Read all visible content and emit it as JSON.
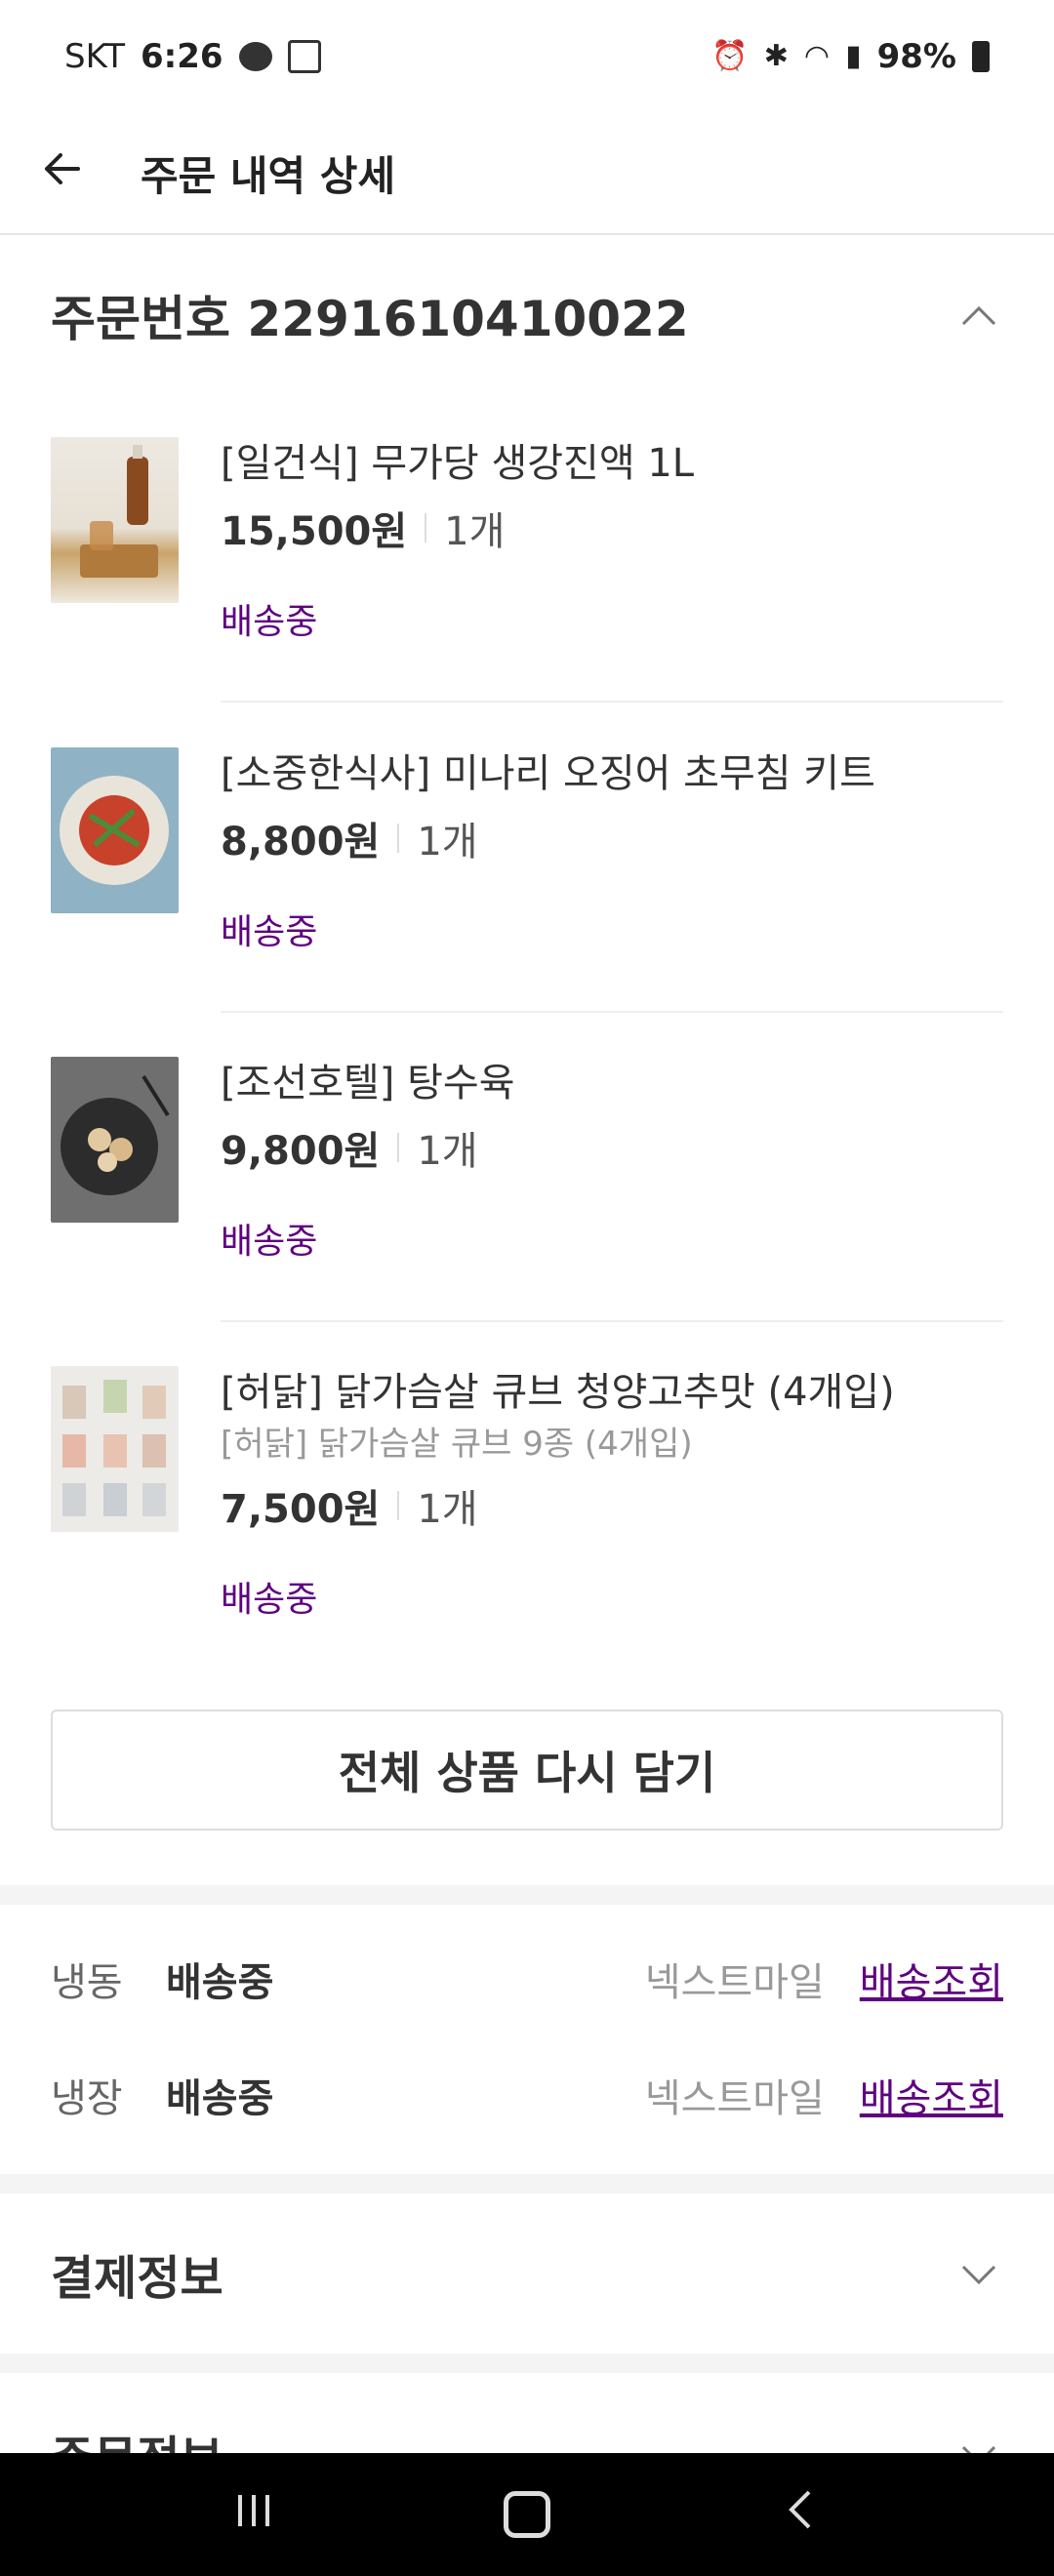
{
  "status_bar": {
    "carrier": "SKT",
    "time": "6:26",
    "battery": "98%"
  },
  "header": {
    "title": "주문 내역 상세"
  },
  "order": {
    "number_label": "주문번호 2291610410022"
  },
  "items": [
    {
      "name": "[일건식] 무가당 생강진액 1L",
      "price": "15,500원",
      "qty": "1개",
      "status": "배송중"
    },
    {
      "name": "[소중한식사] 미나리 오징어 초무침 키트",
      "price": "8,800원",
      "qty": "1개",
      "status": "배송중"
    },
    {
      "name": "[조선호텔] 탕수육",
      "price": "9,800원",
      "qty": "1개",
      "status": "배송중"
    },
    {
      "name": "[허닭] 닭가슴살 큐브 청양고추맛 (4개입)",
      "option": "[허닭] 닭가슴살 큐브 9종 (4개입)",
      "price": "7,500원",
      "qty": "1개",
      "status": "배송중"
    }
  ],
  "reorder_label": "전체 상품 다시 담기",
  "delivery": [
    {
      "type": "냉동",
      "status": "배송중",
      "carrier": "넥스트마일",
      "track": "배송조회"
    },
    {
      "type": "냉장",
      "status": "배송중",
      "carrier": "넥스트마일",
      "track": "배송조회"
    }
  ],
  "sections": {
    "payment": "결제정보",
    "order_info": "주문정보"
  },
  "colors": {
    "accent": "#5f0080"
  }
}
